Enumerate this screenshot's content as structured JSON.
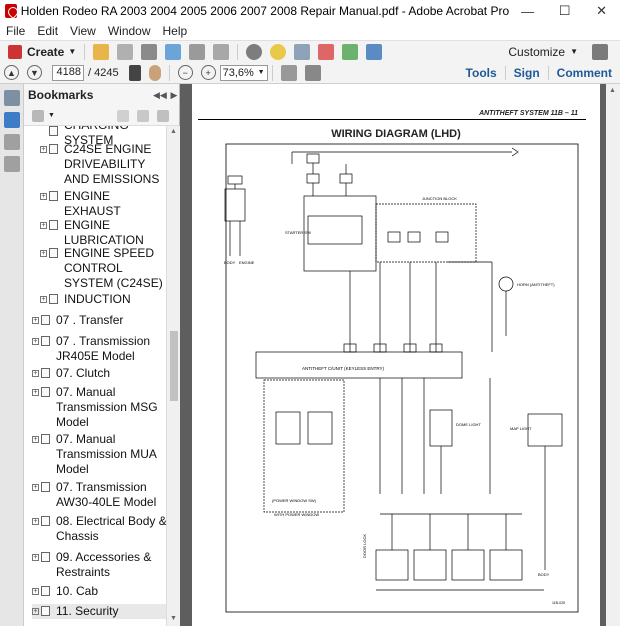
{
  "window": {
    "title": "Holden Rodeo RA 2003 2004 2005 2006 2007 2008 Repair Manual.pdf - Adobe Acrobat Pro",
    "minimize": "—",
    "maximize": "☐",
    "close": "✕"
  },
  "menu": [
    "File",
    "Edit",
    "View",
    "Window",
    "Help"
  ],
  "toolbar": {
    "create_label": "Create",
    "customize_label": "Customize"
  },
  "nav": {
    "current_page": "4188",
    "total_pages": "/ 4245",
    "zoom": "73,6%",
    "tools": "Tools",
    "sign": "Sign",
    "comment": "Comment"
  },
  "bookmarks": {
    "header": "Bookmarks",
    "items": [
      {
        "label": "CHARGING SYSTEM",
        "indent": 1,
        "expander": "",
        "selected": false
      },
      {
        "label": "C24SE ENGINE DRIVEABILITY AND EMISSIONS",
        "indent": 1,
        "expander": "+",
        "selected": false
      },
      {
        "label": "ENGINE EXHAUST",
        "indent": 1,
        "expander": "+",
        "selected": false
      },
      {
        "label": "ENGINE LUBRICATION",
        "indent": 1,
        "expander": "+",
        "selected": false
      },
      {
        "label": "ENGINE SPEED CONTROL SYSTEM (C24SE)",
        "indent": 1,
        "expander": "+",
        "selected": false
      },
      {
        "label": "INDUCTION",
        "indent": 1,
        "expander": "+",
        "selected": false
      },
      {
        "label": "07 . Transfer",
        "indent": 0,
        "expander": "+",
        "selected": false
      },
      {
        "label": "07 . Transmission JR405E Model",
        "indent": 0,
        "expander": "+",
        "selected": false
      },
      {
        "label": "07. Clutch",
        "indent": 0,
        "expander": "+",
        "selected": false
      },
      {
        "label": "07. Manual Transmission MSG Model",
        "indent": 0,
        "expander": "+",
        "selected": false
      },
      {
        "label": "07. Manual Transmission MUA Model",
        "indent": 0,
        "expander": "+",
        "selected": false
      },
      {
        "label": "07. Transmission AW30-40LE Model",
        "indent": 0,
        "expander": "+",
        "selected": false
      },
      {
        "label": "08. Electrical Body & Chassis",
        "indent": 0,
        "expander": "+",
        "selected": false
      },
      {
        "label": "09. Accessories & Restraints",
        "indent": 0,
        "expander": "+",
        "selected": false
      },
      {
        "label": "10. Cab",
        "indent": 0,
        "expander": "+",
        "selected": false
      },
      {
        "label": "11. Security",
        "indent": 0,
        "expander": "+",
        "selected": true
      }
    ]
  },
  "page": {
    "header": "ANTITHEFT SYSTEM  11B – 11",
    "title": "WIRING DIAGRAM (LHD)",
    "diagram": {
      "starter_label": "STARTER SW",
      "junction_label": "JUNCTION BLOCK",
      "antitheft_label": "ANTITHEFT C/UNIT (KEYLESS ENTRY)",
      "horn_label": "HORN (ANTITHEFT)",
      "dome_label": "DOME LIGHT",
      "map_label": "MAP LIGHT",
      "power_window_label": "(POWER WINDOW SW)",
      "with_power_window": "WITH POWER WINDOW",
      "door_lock_label": "DOOR LOCK",
      "body_earth": "BODY",
      "engine_earth": "ENGINE",
      "footer_code": "11B-025"
    }
  },
  "colors": {
    "title_bar": "#ffffff",
    "link_blue": "#1e5a96",
    "doc_bg": "#5e5e5e"
  }
}
